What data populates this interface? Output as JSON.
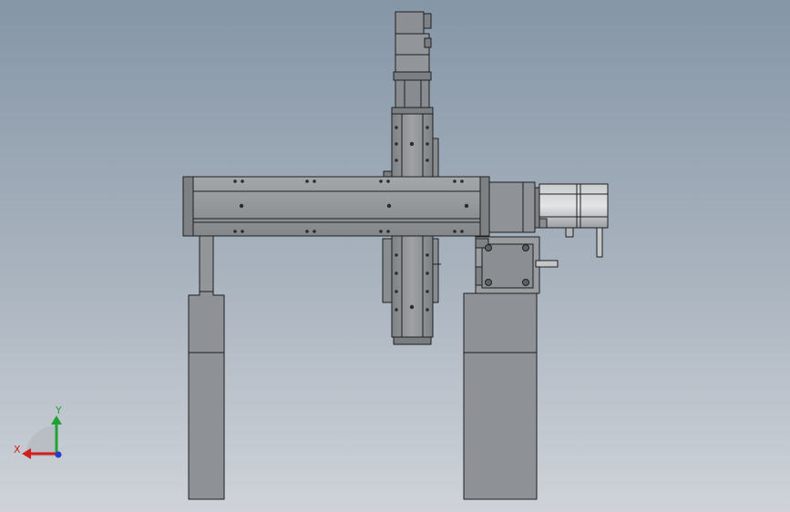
{
  "view": {
    "background_top": "#8596a7",
    "background_bottom": "#cfd3d9",
    "part_fill": "#8f9296",
    "part_light": "#a7aaad",
    "part_dark": "#6f7275",
    "edge_color": "#1e1f21"
  },
  "triad": {
    "x_label": "X",
    "y_label": "Y",
    "x_color": "#d21e1e",
    "y_color": "#22a236",
    "z_color": "#2440c8"
  }
}
